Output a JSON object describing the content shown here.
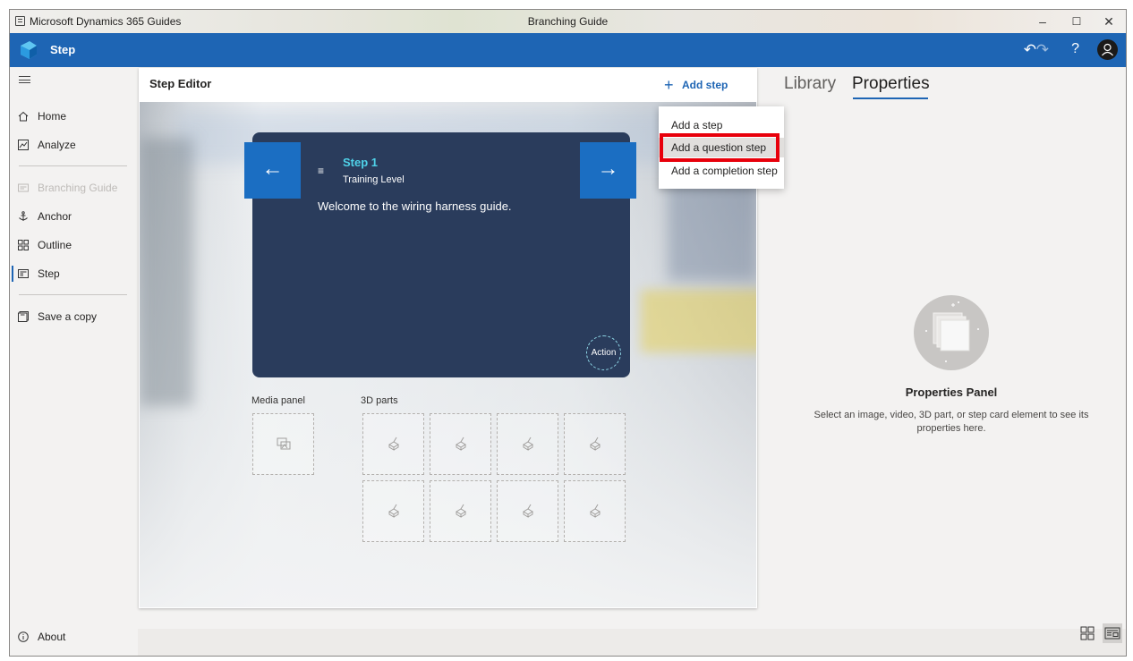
{
  "titlebar": {
    "app_name": "Microsoft Dynamics 365 Guides",
    "document_title": "Branching Guide",
    "minimize": "–",
    "maximize": "☐",
    "close": "✕"
  },
  "appbar": {
    "mode_title": "Step",
    "undo": "↶",
    "redo": "↷",
    "help": "?",
    "accent_color": "#1e65b4"
  },
  "sidebar": {
    "items": [
      {
        "label": "Home",
        "icon": "home-icon"
      },
      {
        "label": "Analyze",
        "icon": "analyze-icon"
      },
      {
        "label": "Branching Guide",
        "icon": "branching-guide-icon",
        "disabled": true
      },
      {
        "label": "Anchor",
        "icon": "anchor-icon"
      },
      {
        "label": "Outline",
        "icon": "outline-icon"
      },
      {
        "label": "Step",
        "icon": "step-icon",
        "active": true
      },
      {
        "label": "Save a copy",
        "icon": "save-icon"
      }
    ],
    "about": "About"
  },
  "editor": {
    "title": "Step Editor",
    "add_step_label": "Add step",
    "add_step_plus": "+",
    "step_card": {
      "step_number": "Step 1",
      "level": "Training Level",
      "body": "Welcome to the wiring harness guide.",
      "action_label": "Action",
      "prev_arrow": "←",
      "next_arrow": "→",
      "list_glyph": "≡"
    },
    "media_panel_label": "Media panel",
    "parts_label": "3D parts"
  },
  "dropdown": {
    "items": [
      "Add a step",
      "Add a question step",
      "Add a completion step"
    ],
    "highlight_color": "#e8000b"
  },
  "right_panel": {
    "tabs": [
      "Library",
      "Properties"
    ],
    "active_tab": "Properties",
    "title": "Properties Panel",
    "description": "Select an image, video, 3D part, or step card element to see its properties here."
  }
}
